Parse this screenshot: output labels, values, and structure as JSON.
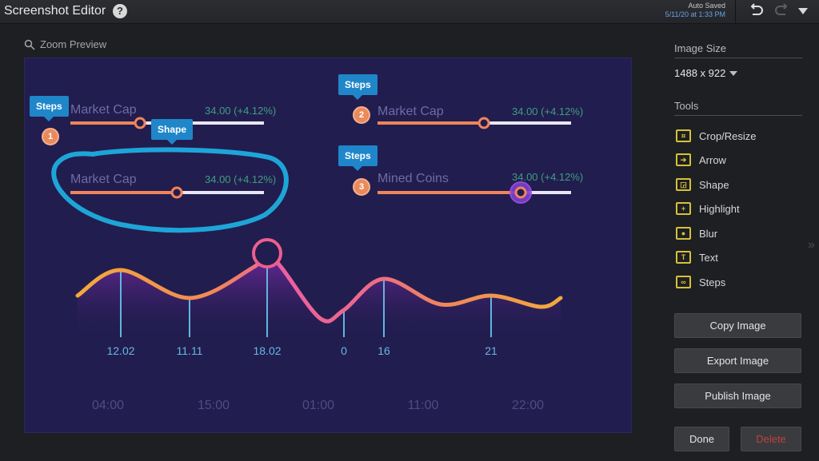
{
  "titlebar": {
    "title": "Screenshot Editor",
    "help_icon": "?",
    "autosave_label": "Auto Saved",
    "autosave_time": "5/11/20 at 1:33 PM",
    "undo_icon": "undo-icon",
    "redo_icon": "redo-icon",
    "menu_icon": "caret-down-icon"
  },
  "preview": {
    "label": "Zoom Preview",
    "icon": "search-icon"
  },
  "canvas": {
    "sliders": [
      {
        "label": "Market Cap",
        "value": "34.00 (+4.12%)",
        "fraction": 0.36,
        "callout": "Steps",
        "step": "1"
      },
      {
        "label": "Market Cap",
        "value": "34.00 (+4.12%)",
        "fraction": 0.55,
        "callout": "Shape",
        "step": null
      },
      {
        "label": "Market Cap",
        "value": "34.00 (+4.12%)",
        "fraction": 0.55,
        "callout": "Steps",
        "step": "2"
      },
      {
        "label": "Mined Coins",
        "value": "34.00 (+4.12%)",
        "fraction": 0.74,
        "callout": "Steps",
        "step": "3"
      }
    ],
    "chart": {
      "data_labels": [
        "12.02",
        "11.11",
        "18.02",
        "0",
        "16",
        "21"
      ],
      "time_labels": [
        "04:00",
        "15:00",
        "01:00",
        "11:00",
        "22:00"
      ]
    },
    "colors": {
      "background": "#221d4f",
      "orange": "#f0845a",
      "pink": "#ec5fa0",
      "yellow": "#f2aa3a",
      "annotation_blue": "#1ea5d8",
      "callout_blue": "#1f86c9"
    }
  },
  "panel": {
    "image_size_heading": "Image Size",
    "image_size_value": "1488 x 922",
    "tools_heading": "Tools",
    "tools": [
      {
        "label": "Crop/Resize",
        "icon": "crop-icon",
        "glyph": "⌗"
      },
      {
        "label": "Arrow",
        "icon": "arrow-icon",
        "glyph": "➔"
      },
      {
        "label": "Shape",
        "icon": "shape-icon",
        "glyph": "◲"
      },
      {
        "label": "Highlight",
        "icon": "highlight-icon",
        "glyph": "+"
      },
      {
        "label": "Blur",
        "icon": "blur-icon",
        "glyph": "●"
      },
      {
        "label": "Text",
        "icon": "text-icon",
        "glyph": "T"
      },
      {
        "label": "Steps",
        "icon": "steps-icon",
        "glyph": "∞"
      }
    ],
    "buttons": {
      "copy": "Copy Image",
      "export": "Export Image",
      "publish": "Publish Image",
      "done": "Done",
      "delete": "Delete"
    },
    "expand_icon": "»"
  }
}
